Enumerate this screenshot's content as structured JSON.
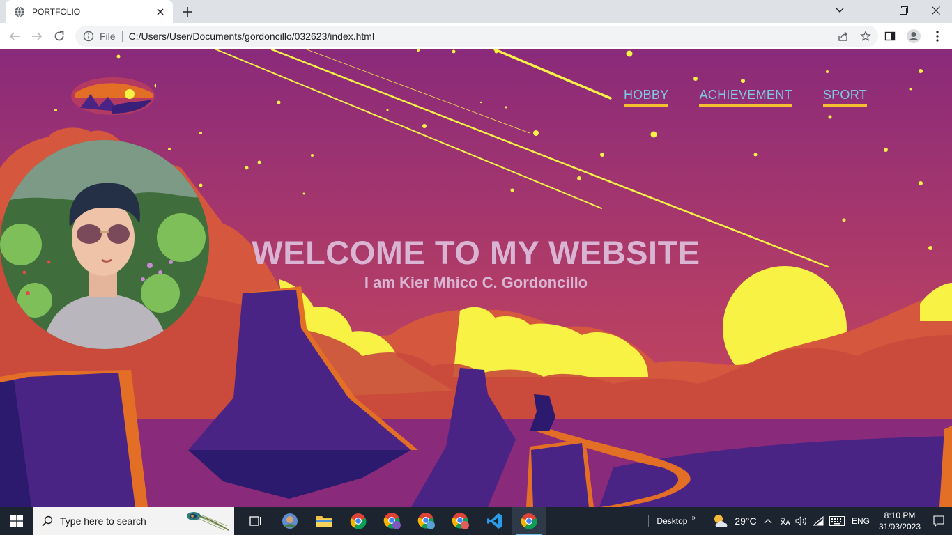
{
  "browser": {
    "tab_title": "PORTFOLIO",
    "omnibox": {
      "scheme_label": "File",
      "url": "C:/Users/User/Documents/gordoncillo/032623/index.html"
    }
  },
  "page": {
    "nav": {
      "hobby": "HOBBY",
      "achievement": "ACHIEVEMENT",
      "sport": "SPORT"
    },
    "hero": {
      "title": "WELCOME TO MY WEBSITE",
      "subtitle": "I am Kier Mhico C. Gordoncillo"
    },
    "colors": {
      "sky_top": "#8a2a7a",
      "sky_bottom": "#c54660",
      "clouds": "#d4573e",
      "highlight": "#f8f245",
      "rock": "#4a2485",
      "nav_text": "#7ec8e3",
      "nav_underline": "#f5c030",
      "hero_text": "#d9b4d3"
    }
  },
  "taskbar": {
    "search_placeholder": "Type here to search",
    "apps": [
      "file-explorer",
      "chrome",
      "chrome-profile-1",
      "chrome-profile-2",
      "chrome-profile-3",
      "vscode",
      "chrome-active"
    ],
    "desktop_label": "Desktop",
    "temperature": "29°C",
    "language": "ENG",
    "time": "8:10 PM",
    "date": "31/03/2023"
  }
}
